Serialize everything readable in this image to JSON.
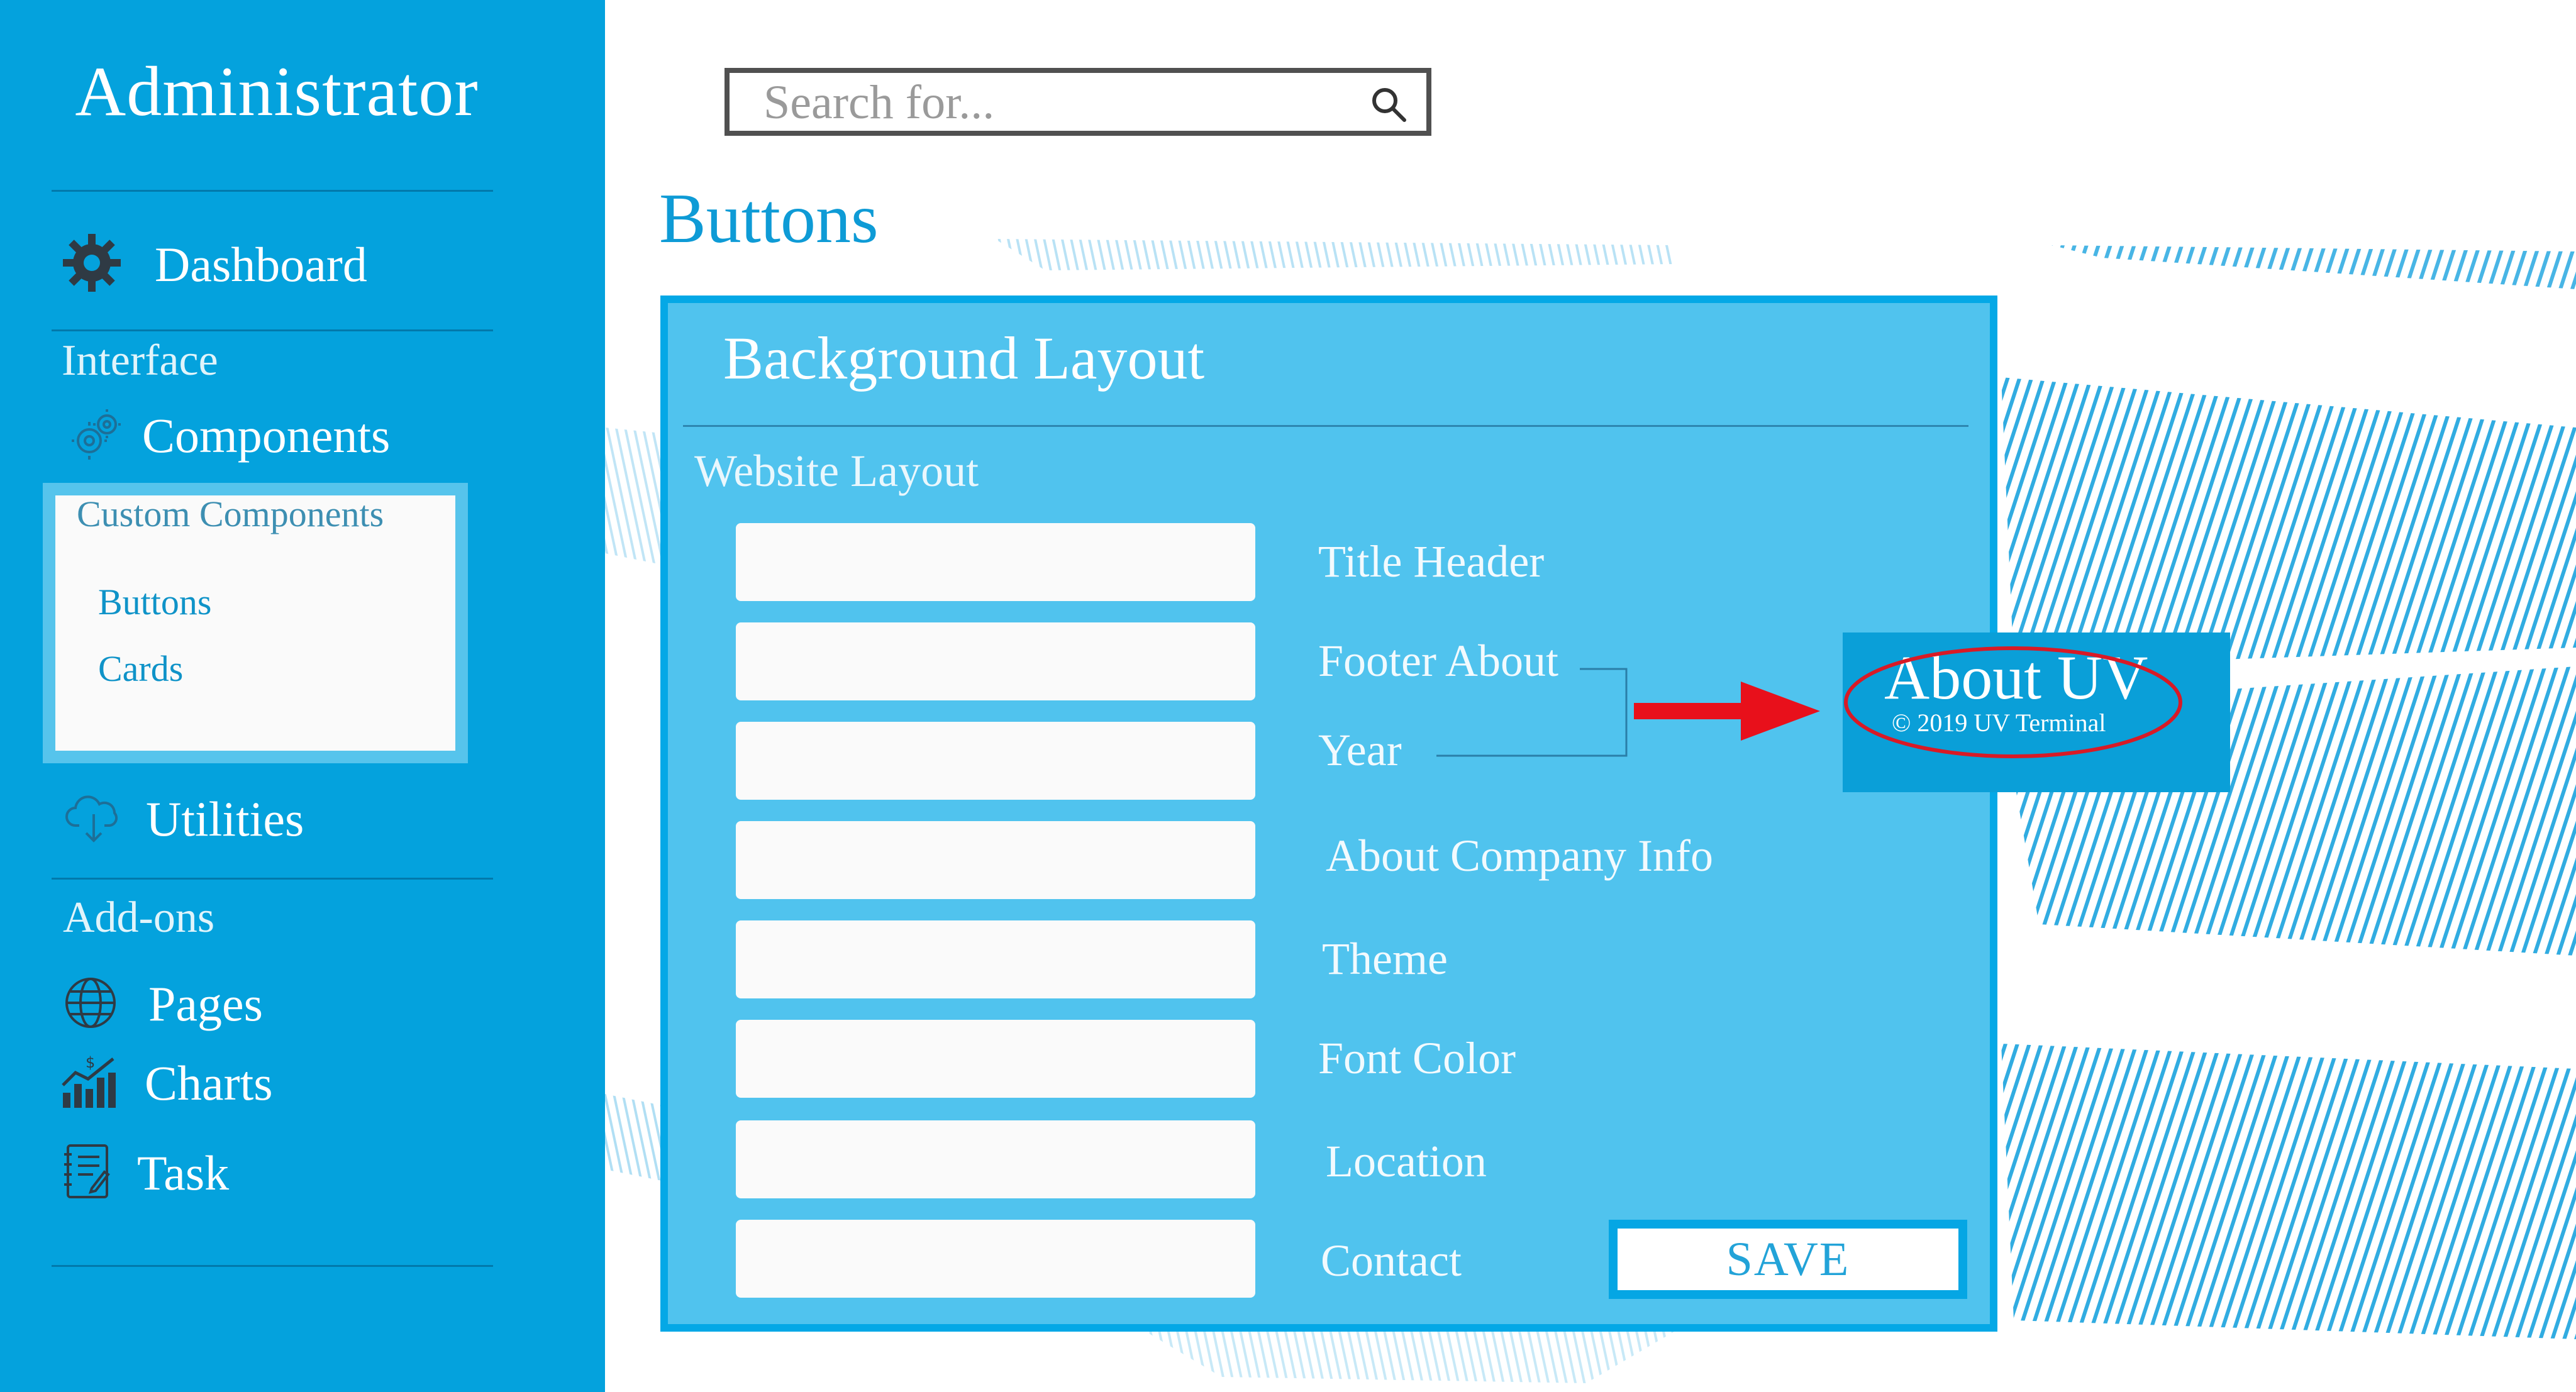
{
  "colors": {
    "sidebar_bg": "#04a2dd",
    "accent": "#0e9bd6",
    "panel_bg": "#50c3ee",
    "panel_border": "#04a8e6",
    "annotation_red": "#e8101b"
  },
  "sidebar": {
    "brand": "Administrator",
    "dashboard": {
      "label": "Dashboard",
      "icon": "gear-icon"
    },
    "interface_heading": "Interface",
    "components": {
      "label": "Components",
      "icon": "cogs-icon"
    },
    "custom_components": {
      "heading": "Custom Components",
      "links": [
        "Buttons",
        "Cards"
      ]
    },
    "utilities": {
      "label": "Utilities",
      "icon": "cloud-download-icon"
    },
    "addons_heading": "Add-ons",
    "pages": {
      "label": "Pages",
      "icon": "globe-icon"
    },
    "charts": {
      "label": "Charts",
      "icon": "chart-icon"
    },
    "task": {
      "label": "Task",
      "icon": "notebook-icon"
    }
  },
  "search": {
    "placeholder": "Search for...",
    "icon": "search-icon"
  },
  "page_title": "Buttons",
  "panel": {
    "title": "Background Layout",
    "subtitle": "Website Layout",
    "fields": [
      {
        "label": "Title Header",
        "value": ""
      },
      {
        "label": "Footer About",
        "value": ""
      },
      {
        "label": "Year",
        "value": ""
      },
      {
        "label": "About Company Info",
        "value": ""
      },
      {
        "label": "Theme",
        "value": ""
      },
      {
        "label": "Font Color",
        "value": ""
      },
      {
        "label": "Location",
        "value": ""
      },
      {
        "label": "Contact",
        "value": ""
      }
    ],
    "save_label": "SAVE"
  },
  "preview": {
    "title": "About UV",
    "copyright": "© 2019 UV Terminal"
  }
}
